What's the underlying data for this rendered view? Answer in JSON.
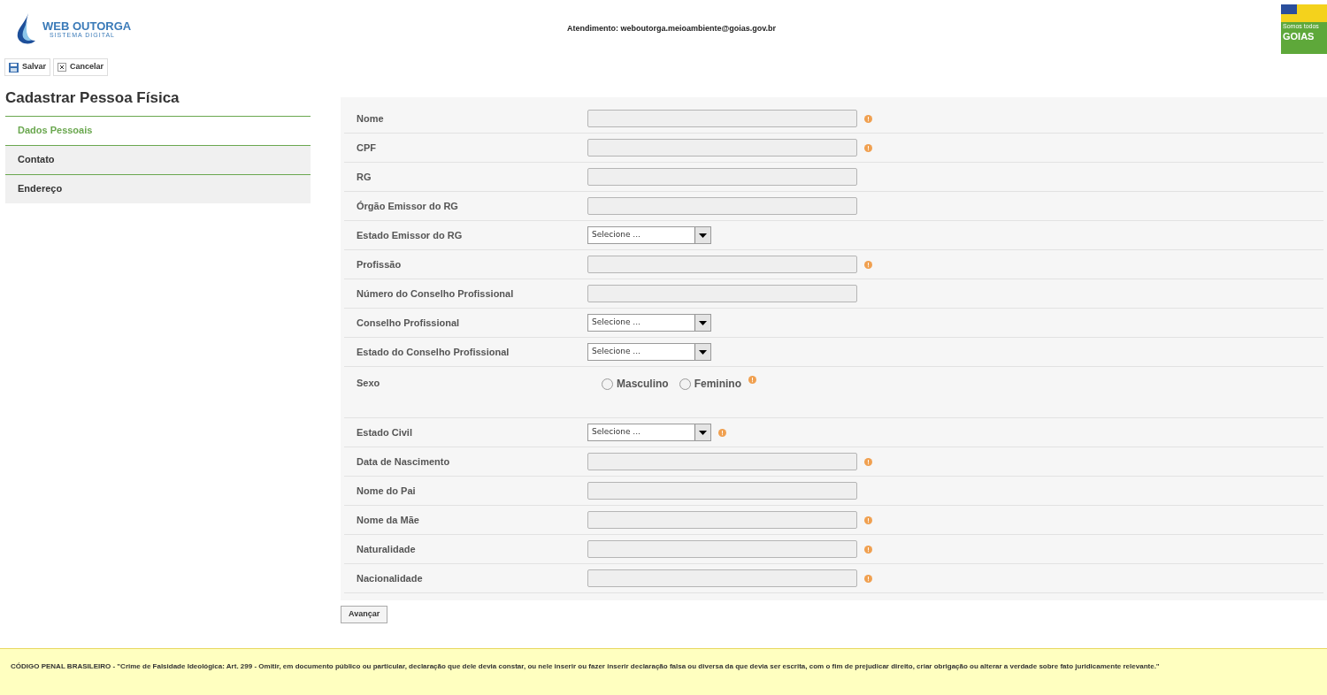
{
  "header": {
    "logo_title": "WEB OUTORGA",
    "logo_subtitle": "SISTEMA DIGITAL",
    "contact": "Atendimento: weboutorga.meioambiente@goias.gov.br",
    "gov_logo_small": "Somos todos",
    "gov_logo_text": "GOIAS"
  },
  "toolbar": [
    {
      "label": "Salvar",
      "kind": "save"
    },
    {
      "label": "Cancelar",
      "kind": "cancel"
    }
  ],
  "page_title": "Cadastrar Pessoa Física",
  "sidebar": {
    "items": [
      {
        "label": "Dados Pessoais",
        "selected": true
      },
      {
        "label": "Contato",
        "selected": false
      },
      {
        "label": "Endereço",
        "selected": false
      }
    ]
  },
  "form": {
    "rows": [
      {
        "label": "Nome",
        "kind": "text",
        "required": true
      },
      {
        "label": "CPF",
        "kind": "text",
        "required": true
      },
      {
        "label": "RG",
        "kind": "text",
        "required": false
      },
      {
        "label": "Órgão Emissor do RG",
        "kind": "text",
        "required": false
      },
      {
        "label": "Estado Emissor do RG",
        "kind": "select",
        "placeholder": "Selecione ...",
        "required": false
      },
      {
        "label": "Profissão",
        "kind": "text",
        "required": true
      },
      {
        "label": "Número do Conselho Profissional",
        "kind": "text",
        "required": false
      },
      {
        "label": "Conselho Profissional",
        "kind": "select",
        "placeholder": "Selecione ...",
        "required": false
      },
      {
        "label": "Estado do Conselho Profissional",
        "kind": "select",
        "placeholder": "Selecione ...",
        "required": false
      },
      {
        "label": "Sexo",
        "kind": "radio",
        "required": true,
        "options": [
          {
            "label": "Masculino",
            "selected": false
          },
          {
            "label": "Feminino",
            "selected": false
          }
        ]
      },
      {
        "label": "Estado Civil",
        "kind": "select",
        "placeholder": "Selecione ...",
        "required": true
      },
      {
        "label": "Data de Nascimento",
        "kind": "text",
        "required": true
      },
      {
        "label": "Nome do Pai",
        "kind": "text",
        "required": false
      },
      {
        "label": "Nome da Mãe",
        "kind": "text",
        "required": true
      },
      {
        "label": "Naturalidade",
        "kind": "text",
        "required": true
      },
      {
        "label": "Nacionalidade",
        "kind": "text",
        "required": true
      }
    ],
    "next_button": "Avançar"
  },
  "footer": {
    "notice": "CÓDIGO PENAL BRASILEIRO - \"Crime de Falsidade Ideológica: Art. 299 - Omitir, em documento público ou particular, declaração que dele devia constar, ou nele inserir ou fazer inserir declaração falsa ou diversa da que devia ser escrita, com o fim de prejudicar direito, criar obrigação ou alterar a verdade sobre fato juridicamente relevante.\""
  }
}
